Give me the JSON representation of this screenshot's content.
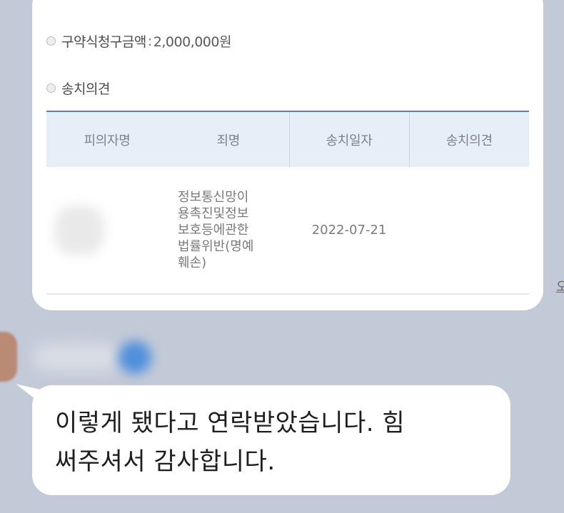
{
  "card": {
    "claim_label": "구약식청구금액",
    "claim_sep": ":",
    "claim_value": "2,000,000원",
    "disposition_label": "송치의견",
    "table": {
      "headers": [
        "피의자명",
        "죄명",
        "송치일자",
        "송치의견"
      ],
      "row": {
        "suspect": "",
        "charge_lines": [
          "정보통신망이",
          "용촉진및정보",
          "보호등에관한",
          "법률위반(명예",
          "훼손)"
        ],
        "date": "2022-07-21",
        "opinion": ""
      }
    }
  },
  "edge_fragment": "오",
  "message": {
    "lines": [
      "이렇게 됐다고 연락받았습니다. 힘",
      "써주셔서 감사합니다."
    ]
  }
}
